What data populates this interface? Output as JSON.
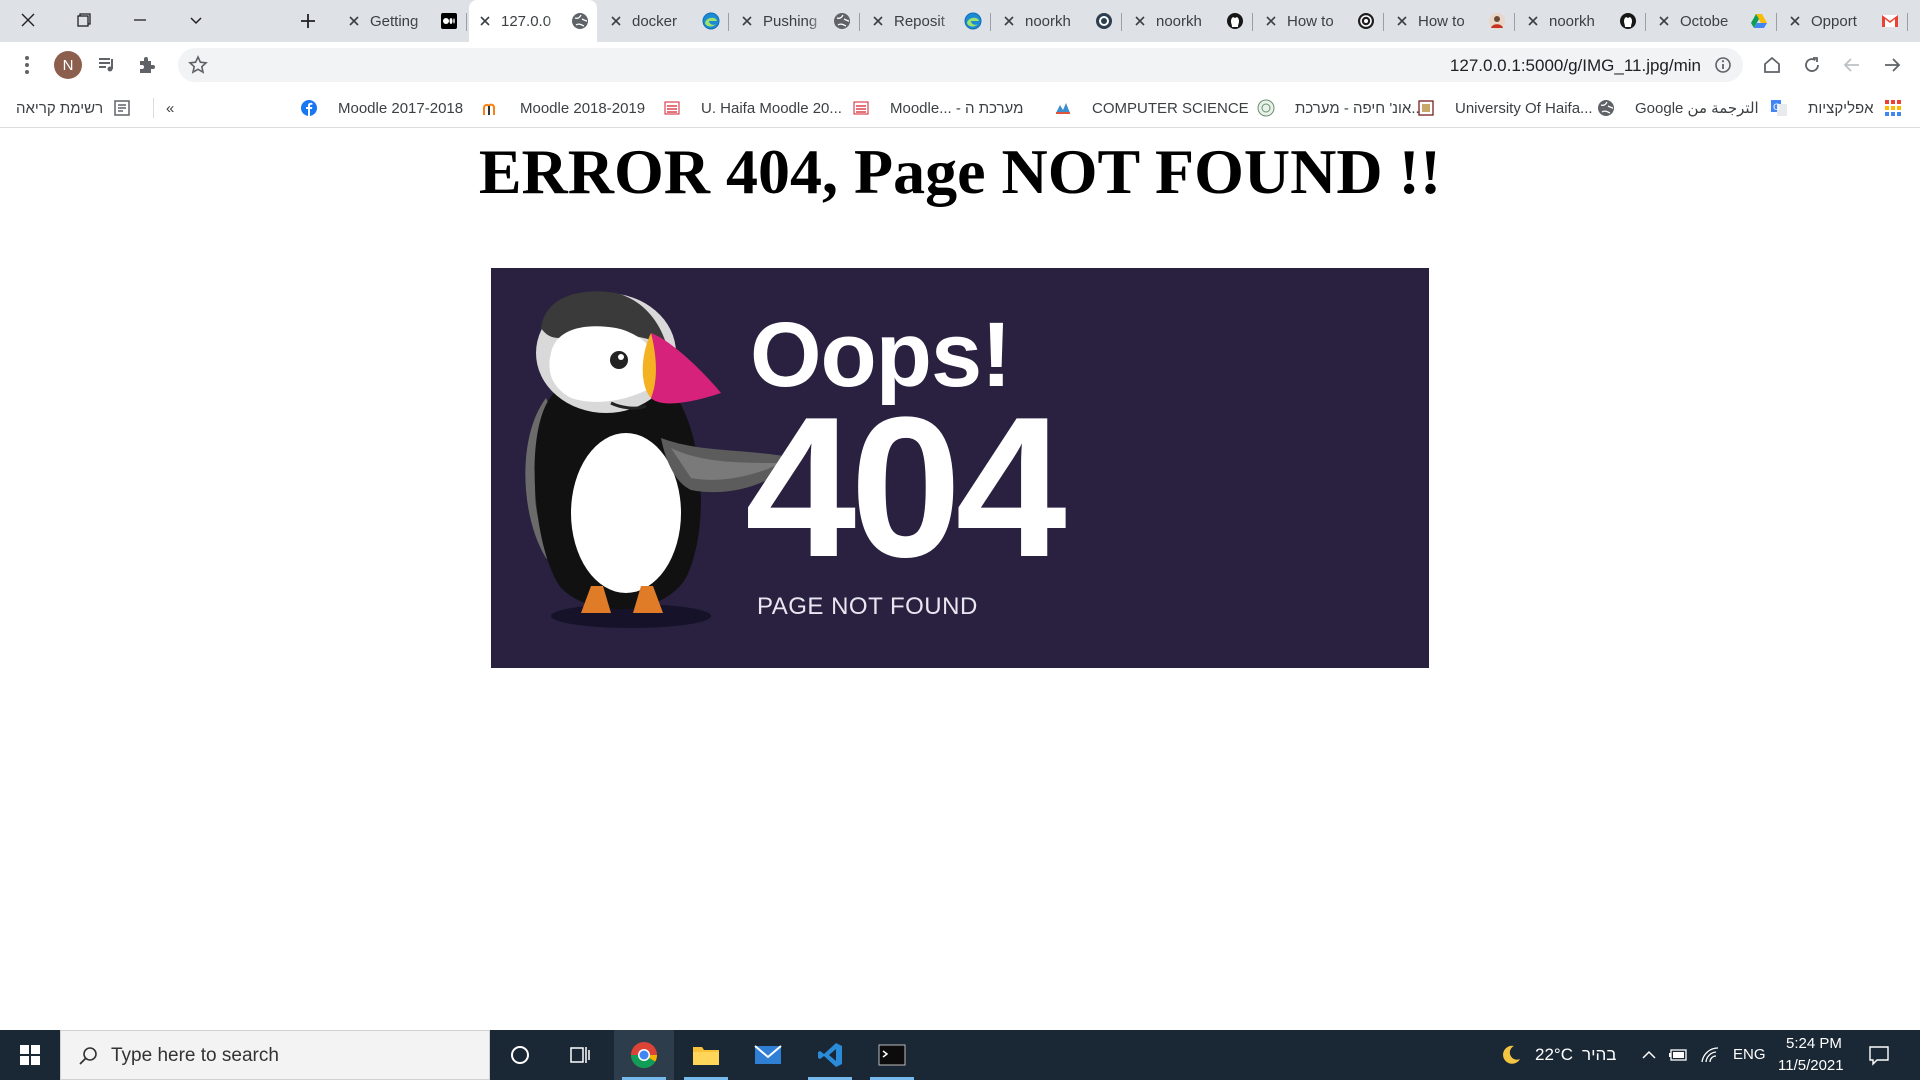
{
  "tabs": [
    {
      "title": "Getting",
      "favicon": "medium-icon"
    },
    {
      "title": "127.0.0",
      "favicon": "globe-icon",
      "active": true
    },
    {
      "title": "docker",
      "favicon": "edge-icon"
    },
    {
      "title": "Pushing",
      "favicon": "globe-icon"
    },
    {
      "title": "Reposit",
      "favicon": "edge-icon"
    },
    {
      "title": "noorkh",
      "favicon": "circle-icon"
    },
    {
      "title": "noorkh",
      "favicon": "github-icon"
    },
    {
      "title": "How to",
      "favicon": "gitkraken-icon"
    },
    {
      "title": "How to",
      "favicon": "avatar-icon"
    },
    {
      "title": "noorkh",
      "favicon": "github-icon"
    },
    {
      "title": "Octobe",
      "favicon": "drive-icon"
    },
    {
      "title": "Opport",
      "favicon": "gmail-icon"
    }
  ],
  "toolbar": {
    "url": "127.0.0.1:5000/g/IMG_11.jpg/min",
    "avatar_initial": "N"
  },
  "bookmarks": {
    "reading_list": "רשימת קריאה",
    "overflow": "«",
    "items": [
      {
        "label": "Moodle 2017-2018",
        "icon": "facebook-icon"
      },
      {
        "label": "Moodle 2018-2019",
        "icon": "moodle-icon"
      },
      {
        "label": "U. Haifa Moodle 20...",
        "icon": "haifa-icon"
      },
      {
        "label": "Moodle... - מערכת ה",
        "icon": "haifa-icon"
      },
      {
        "label": "COMPUTER SCIENCE",
        "icon": "cs-icon"
      },
      {
        "label": "אונ' חיפה - מערכת...",
        "icon": "seal-icon"
      },
      {
        "label": "University Of Haifa...",
        "icon": "library-icon"
      },
      {
        "label": "Google الترجمة من",
        "icon": "globe-icon"
      },
      {
        "label": "אפליקציות",
        "icon": "translate-icon"
      }
    ]
  },
  "page": {
    "heading": "ERROR 404, Page NOT FOUND !!",
    "image": {
      "oops": "Oops!",
      "code": "404",
      "caption": "PAGE NOT FOUND"
    }
  },
  "taskbar": {
    "search_placeholder": "Type here to search",
    "weather_temp": "22°C",
    "weather_desc": "בהיר",
    "language": "ENG",
    "time": "5:24 PM",
    "date": "11/5/2021"
  },
  "colors": {
    "tab_strip": "#dee1e6",
    "image_bg": "#2a2141",
    "beak": "#d6227a",
    "taskbar": "#1a2734"
  }
}
